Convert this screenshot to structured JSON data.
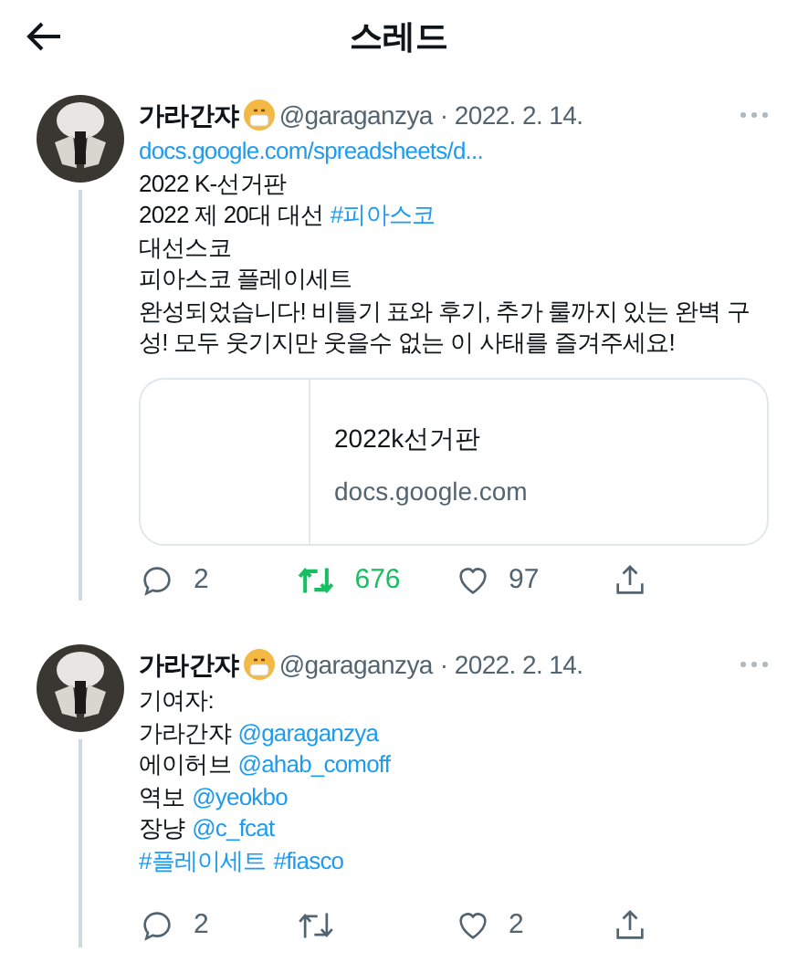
{
  "header": {
    "title": "스레드"
  },
  "tweets": [
    {
      "name": "가라간쟈",
      "handle": "@garaganzya",
      "date": "· 2022. 2. 14.",
      "lines": [
        [
          {
            "text": "docs.google.com/spreadsheets/d...",
            "link": true
          }
        ],
        [
          {
            "text": "2022 K-선거판",
            "link": false
          }
        ],
        [
          {
            "text": "2022 제 20대 대선",
            "link": false
          },
          {
            "text": "#피아스코",
            "link": true
          }
        ],
        [
          {
            "text": "대선스코",
            "link": false
          }
        ],
        [
          {
            "text": "피아스코 플레이세트",
            "link": false
          }
        ],
        [
          {
            "text": "완성되었습니다! 비틀기 표와 후기, 추가 룰까지 있는 완벽 구성! 모두 웃기지만 웃을수 없는 이 사태를 즐겨주세요!",
            "link": false
          }
        ]
      ],
      "card": {
        "title": "2022k선거판",
        "domain": "docs.google.com"
      },
      "replies": "2",
      "retweets": "676",
      "retweeted": true,
      "likes": "97"
    },
    {
      "name": "가라간쟈",
      "handle": "@garaganzya",
      "date": "· 2022. 2. 14.",
      "lines": [
        [
          {
            "text": "기여자:",
            "link": false
          }
        ],
        [
          {
            "text": "가라간쟈",
            "link": false
          },
          {
            "text": "@garaganzya",
            "link": true
          }
        ],
        [
          {
            "text": "에이허브",
            "link": false
          },
          {
            "text": "@ahab_comoff",
            "link": true
          }
        ],
        [
          {
            "text": "역보",
            "link": false
          },
          {
            "text": "@yeokbo",
            "link": true
          }
        ],
        [
          {
            "text": "장냥",
            "link": false
          },
          {
            "text": "@c_fcat",
            "link": true
          }
        ],
        [
          {
            "text": "#플레이세트",
            "link": true
          },
          {
            "text": "#fiasco",
            "link": true
          }
        ]
      ],
      "replies": "2",
      "retweeted": false,
      "likes": "2"
    }
  ]
}
